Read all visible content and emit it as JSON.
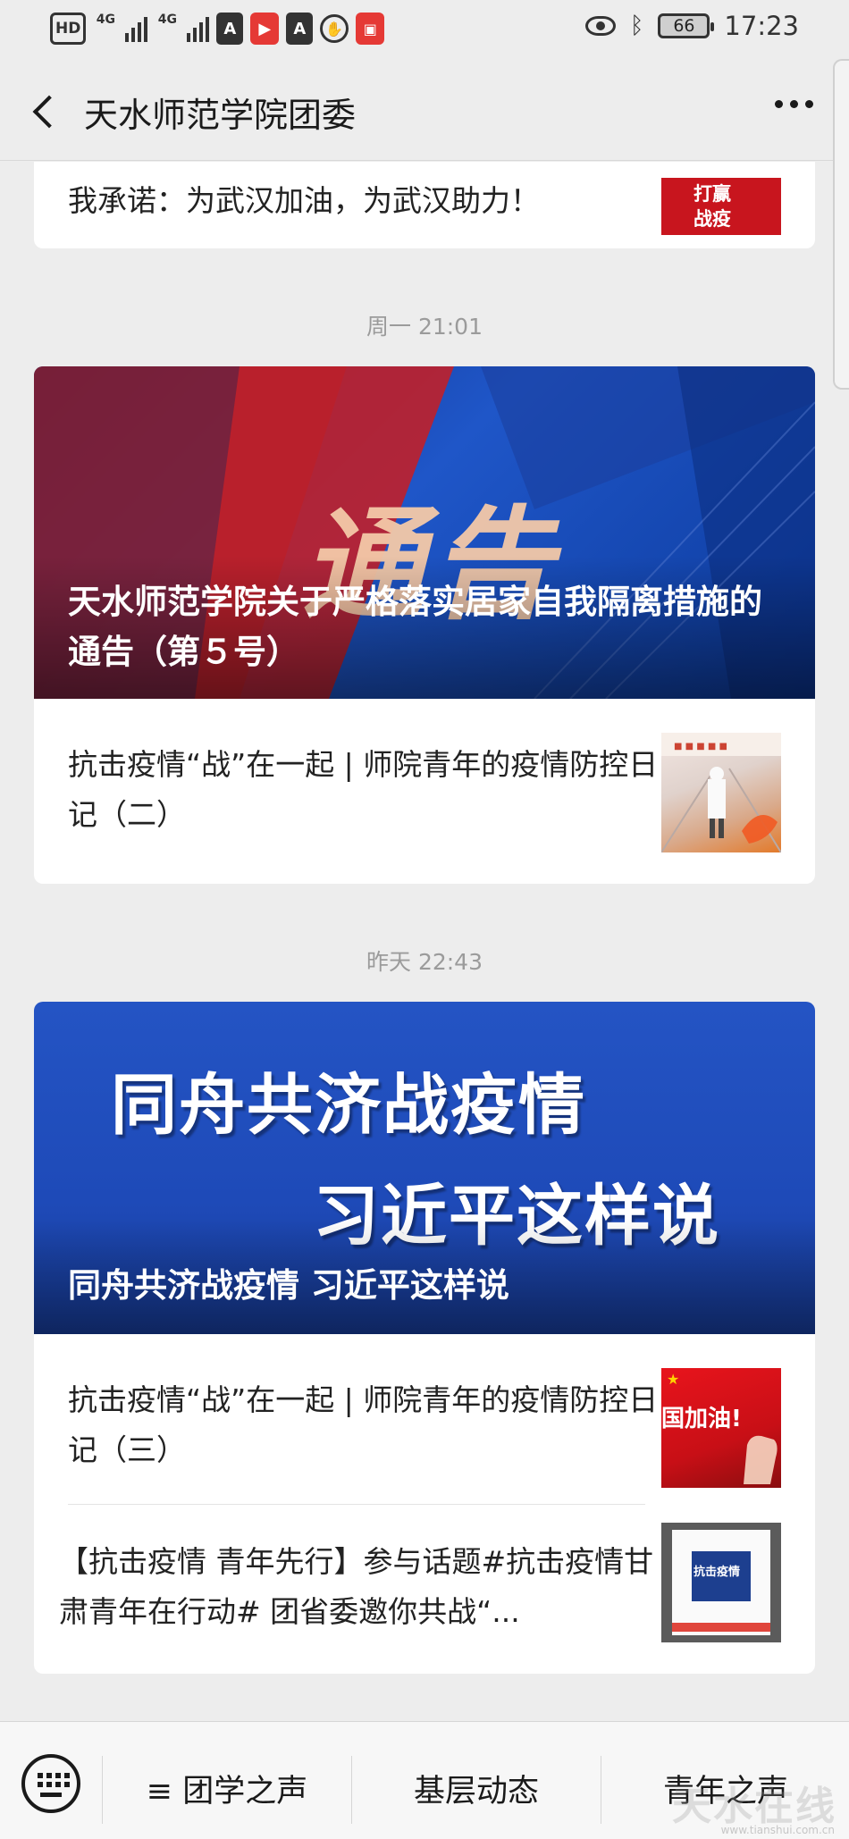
{
  "status_bar": {
    "left_labels": [
      "HD",
      "4G",
      "4G",
      "A",
      "A"
    ],
    "battery": "66",
    "time": "17:23"
  },
  "nav": {
    "title": "天水师范学院团委",
    "back_icon": "chevron-left-icon",
    "more_icon": "more-dots-icon"
  },
  "feed": {
    "top_partial": {
      "title": "我承诺：为武汉加油，为武汉助力！",
      "thumb_text": "打赢战疫"
    },
    "groups": [
      {
        "timestamp": "周一 21:01",
        "hero": {
          "image_text": "通告",
          "title": "天水师范学院关于严格落实居家自我隔离措施的通告（第５号）"
        },
        "items": [
          {
            "title": "抗击疫情“战”在一起 | 师院青年的疫情防控日记（二）"
          }
        ]
      },
      {
        "timestamp": "昨天 22:43",
        "hero": {
          "image_line1": "同舟共济战疫情",
          "image_line2": "习近平这样说",
          "title": "同舟共济战疫情 习近平这样说"
        },
        "items": [
          {
            "title": "抗击疫情“战”在一起 | 师院青年的疫情防控日记（三）",
            "thumb_text": "国加油!"
          },
          {
            "title": "【抗击疫情 青年先行】参与话题#抗击疫情甘肃青年在行动# 团省委邀你共战“...",
            "thumb_text": "抗击疫情"
          }
        ]
      }
    ]
  },
  "bottom_menu": {
    "keyboard_icon": "keyboard-icon",
    "items": [
      "≡ 团学之声",
      "基层动态",
      "青年之声"
    ]
  },
  "watermark": {
    "text": "天水在线",
    "url": "www.tianshui.com.cn"
  },
  "colors": {
    "background": "#ededed",
    "card": "#ffffff",
    "hero_blue": "#1f4fb5",
    "hero_red": "#c0202a"
  }
}
